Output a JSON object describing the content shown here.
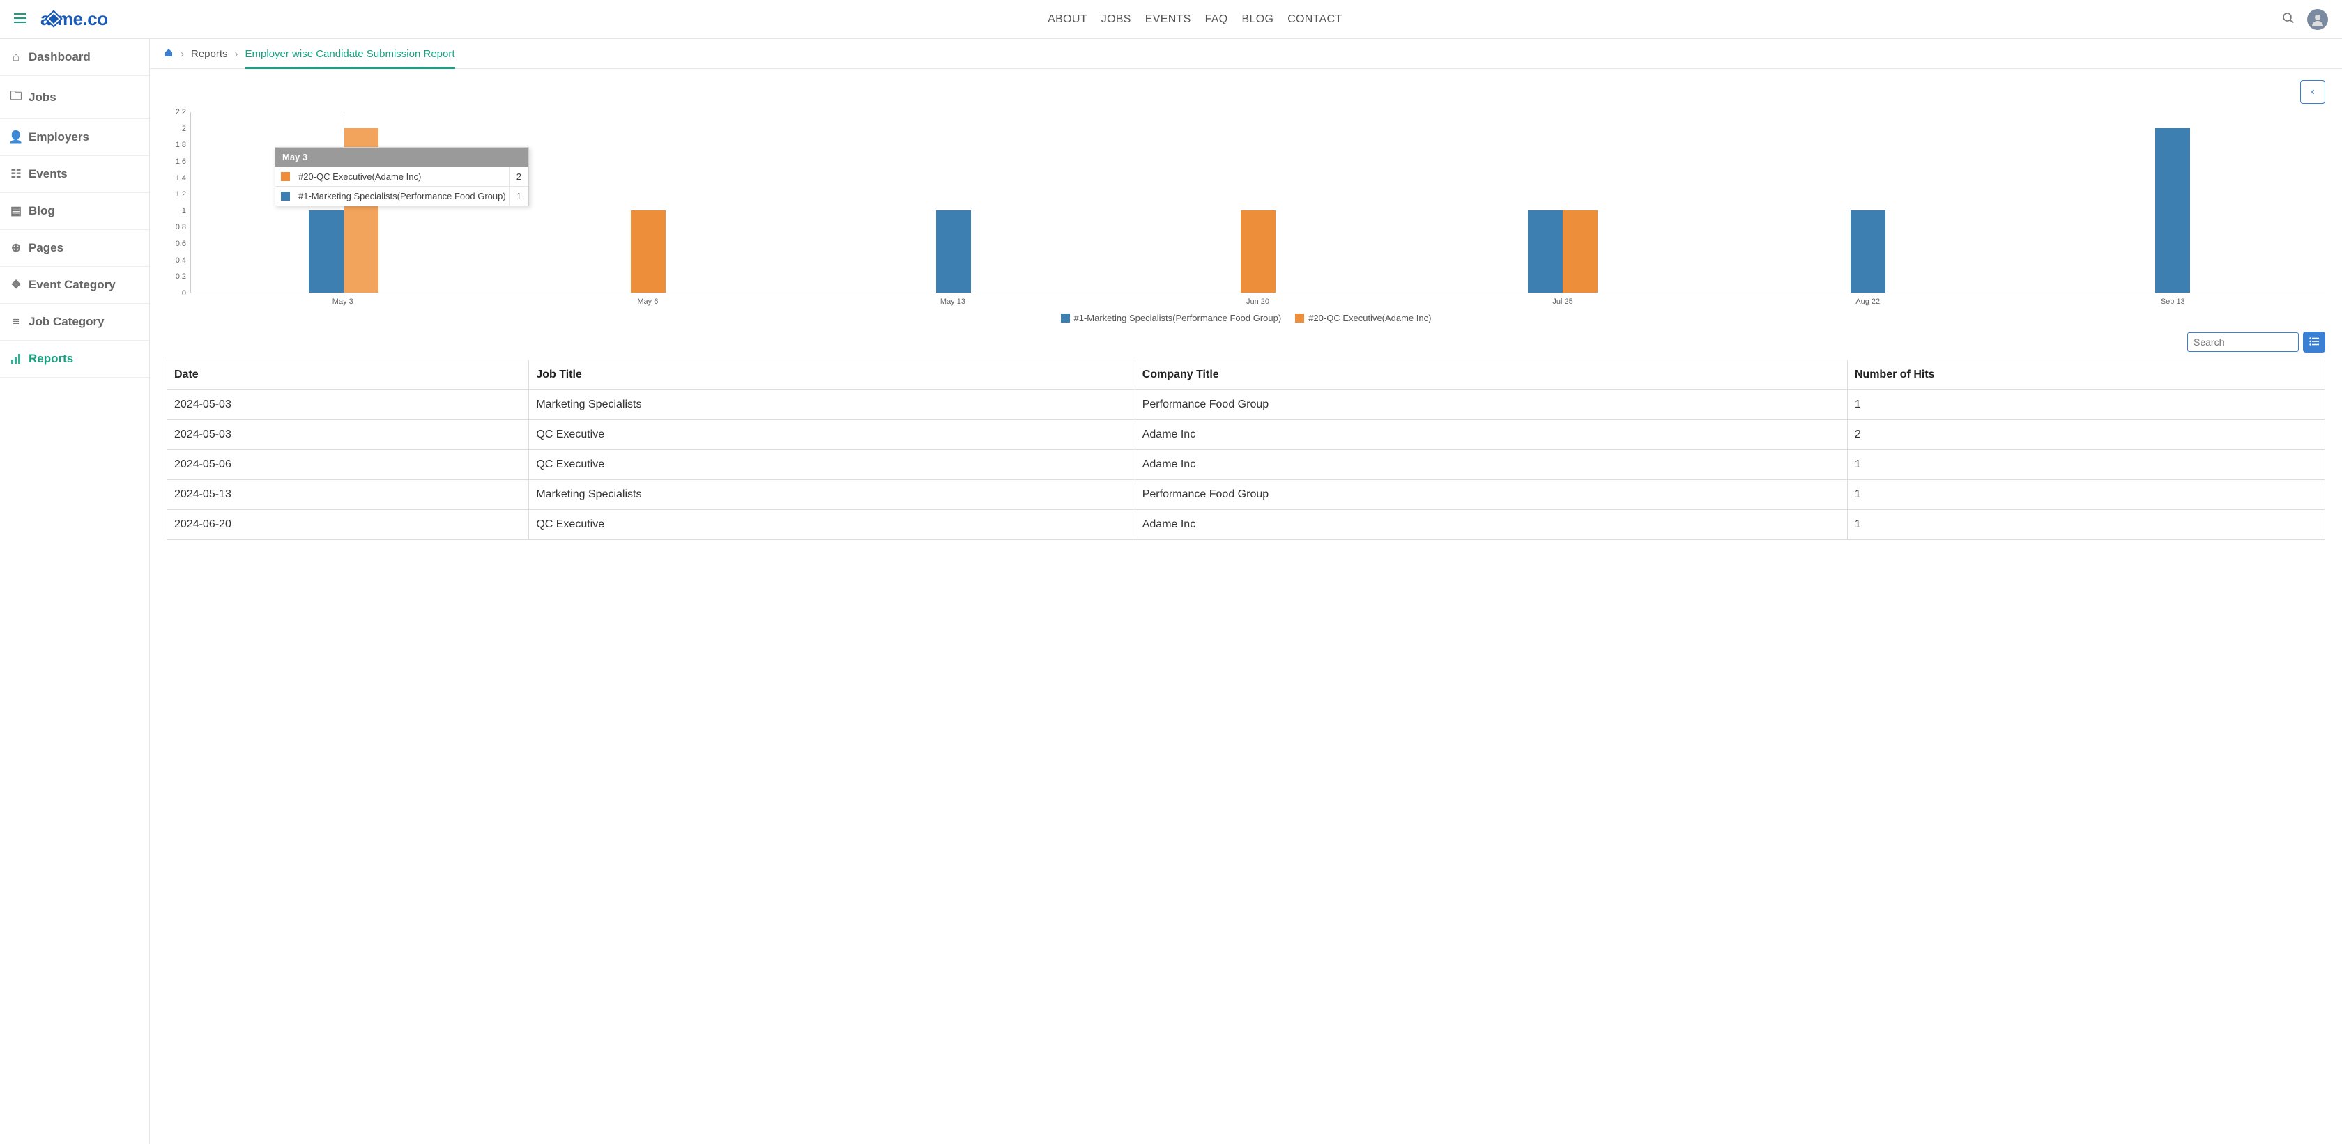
{
  "header": {
    "logo_prefix": "a",
    "logo_suffix": "me.co",
    "nav": [
      "ABOUT",
      "JOBS",
      "EVENTS",
      "FAQ",
      "BLOG",
      "CONTACT"
    ]
  },
  "sidebar": {
    "items": [
      {
        "icon": "home",
        "label": "Dashboard"
      },
      {
        "icon": "briefcase",
        "label": "Jobs"
      },
      {
        "icon": "user",
        "label": "Employers"
      },
      {
        "icon": "calendar",
        "label": "Events"
      },
      {
        "icon": "book",
        "label": "Blog"
      },
      {
        "icon": "globe",
        "label": "Pages"
      },
      {
        "icon": "layers",
        "label": "Event Category"
      },
      {
        "icon": "list",
        "label": "Job Category"
      },
      {
        "icon": "bar-chart",
        "label": "Reports",
        "active": true
      }
    ]
  },
  "breadcrumb": {
    "home_icon": "home",
    "items": [
      {
        "label": "Reports",
        "href": "#"
      }
    ],
    "current": "Employer wise Candidate Submission Report"
  },
  "search": {
    "placeholder": "Search"
  },
  "chart_data": {
    "type": "bar",
    "categories": [
      "May 3",
      "May 6",
      "May 13",
      "Jun 20",
      "Jul 25",
      "Aug 22",
      "Sep 13"
    ],
    "ylim": [
      0,
      2.2
    ],
    "yticks": [
      0,
      0.2,
      0.4,
      0.6,
      0.8,
      1,
      1.2,
      1.4,
      1.6,
      1.8,
      2,
      2.2
    ],
    "series": [
      {
        "name": "#1-Marketing Specialists(Performance Food Group)",
        "color": "blue",
        "values": [
          1,
          0,
          1,
          0,
          1,
          1,
          2
        ]
      },
      {
        "name": "#20-QC Executive(Adame Inc)",
        "color": "orange",
        "values": [
          2,
          1,
          0,
          1,
          1,
          0,
          0
        ]
      }
    ],
    "tooltip": {
      "title": "May 3",
      "rows": [
        {
          "color": "orange",
          "label": "#20-QC Executive(Adame Inc)",
          "value": 2
        },
        {
          "color": "blue",
          "label": "#1-Marketing Specialists(Performance Food Group)",
          "value": 1
        }
      ],
      "hovered_category_index": 0,
      "hovered_series": "orange"
    }
  },
  "table": {
    "headers": [
      "Date",
      "Job Title",
      "Company Title",
      "Number of Hits"
    ],
    "rows": [
      [
        "2024-05-03",
        "Marketing Specialists",
        "Performance Food Group",
        "1"
      ],
      [
        "2024-05-03",
        "QC Executive",
        "Adame Inc",
        "2"
      ],
      [
        "2024-05-06",
        "QC Executive",
        "Adame Inc",
        "1"
      ],
      [
        "2024-05-13",
        "Marketing Specialists",
        "Performance Food Group",
        "1"
      ],
      [
        "2024-06-20",
        "QC Executive",
        "Adame Inc",
        "1"
      ]
    ]
  }
}
